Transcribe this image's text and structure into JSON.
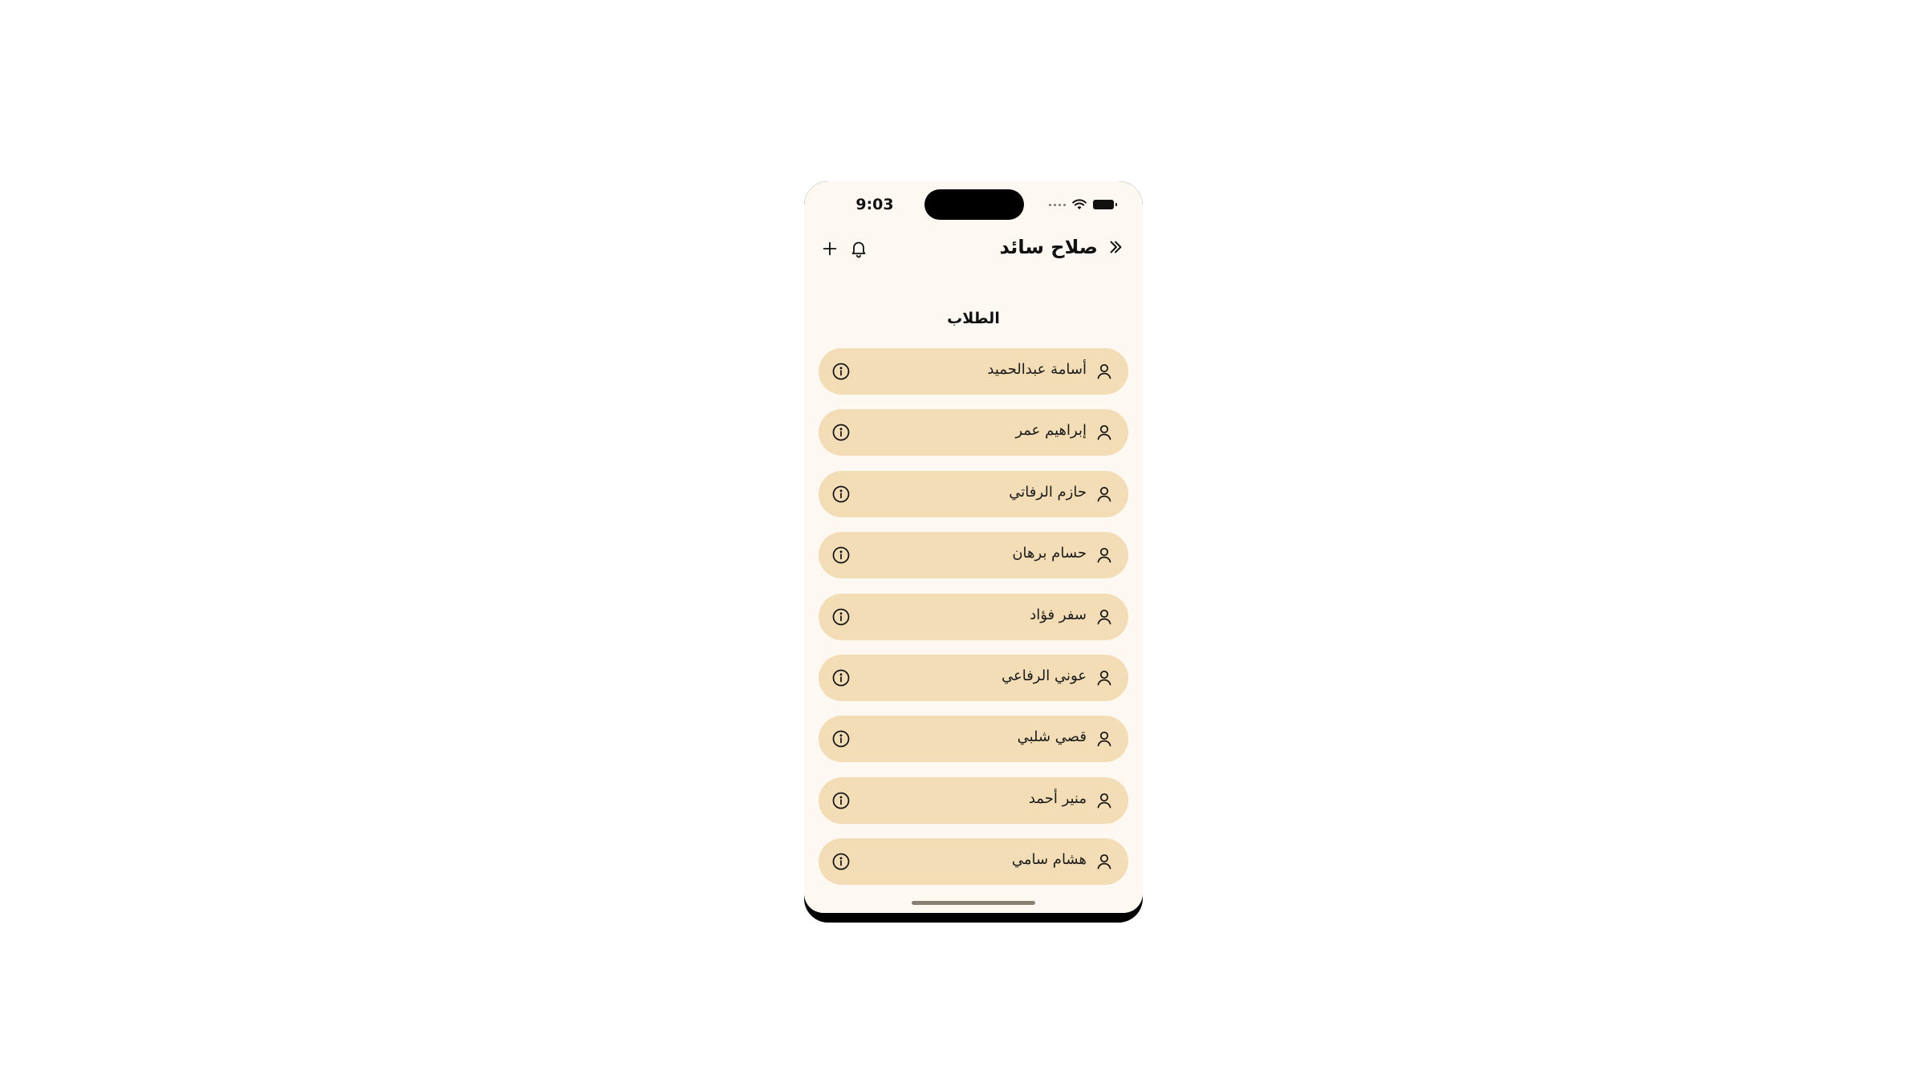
{
  "status_bar": {
    "time": "9:03"
  },
  "header": {
    "title": "صلاح سائد",
    "back_icon": "chevrons-right-icon",
    "notification_icon": "bell-icon",
    "add_icon": "plus-icon"
  },
  "section": {
    "title": "الطلاب"
  },
  "students": [
    {
      "name": "أسامة عبدالحميد"
    },
    {
      "name": "إبراهيم عمر"
    },
    {
      "name": "حازم الرفاتي"
    },
    {
      "name": "حسام برهان"
    },
    {
      "name": "سفر فؤاد"
    },
    {
      "name": "عوني الرفاعي"
    },
    {
      "name": "قصي شلبي"
    },
    {
      "name": "منير أحمد"
    },
    {
      "name": "هشام سامي"
    }
  ],
  "colors": {
    "background": "#fdf8f1",
    "item_background": "#f3ddb6",
    "text": "#111111"
  }
}
